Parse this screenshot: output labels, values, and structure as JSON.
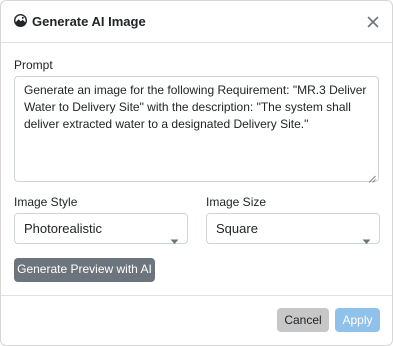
{
  "dialog": {
    "title": "Generate AI Image",
    "icon": "image-icon",
    "close_icon": "close-icon"
  },
  "prompt": {
    "label": "Prompt",
    "value": "Generate an image for the following Requirement: \"MR.3 Deliver Water to Delivery Site\" with the description: \"The system shall deliver extracted water to a designated Delivery Site.\""
  },
  "image_style": {
    "label": "Image Style",
    "selected": "Photorealistic"
  },
  "image_size": {
    "label": "Image Size",
    "selected": "Square"
  },
  "buttons": {
    "preview": "Generate Preview with AI",
    "cancel": "Cancel",
    "apply": "Apply"
  },
  "colors": {
    "preview_button": "#6c757d",
    "cancel_button": "#c7c7c7",
    "apply_button": "#8fc1ea"
  }
}
